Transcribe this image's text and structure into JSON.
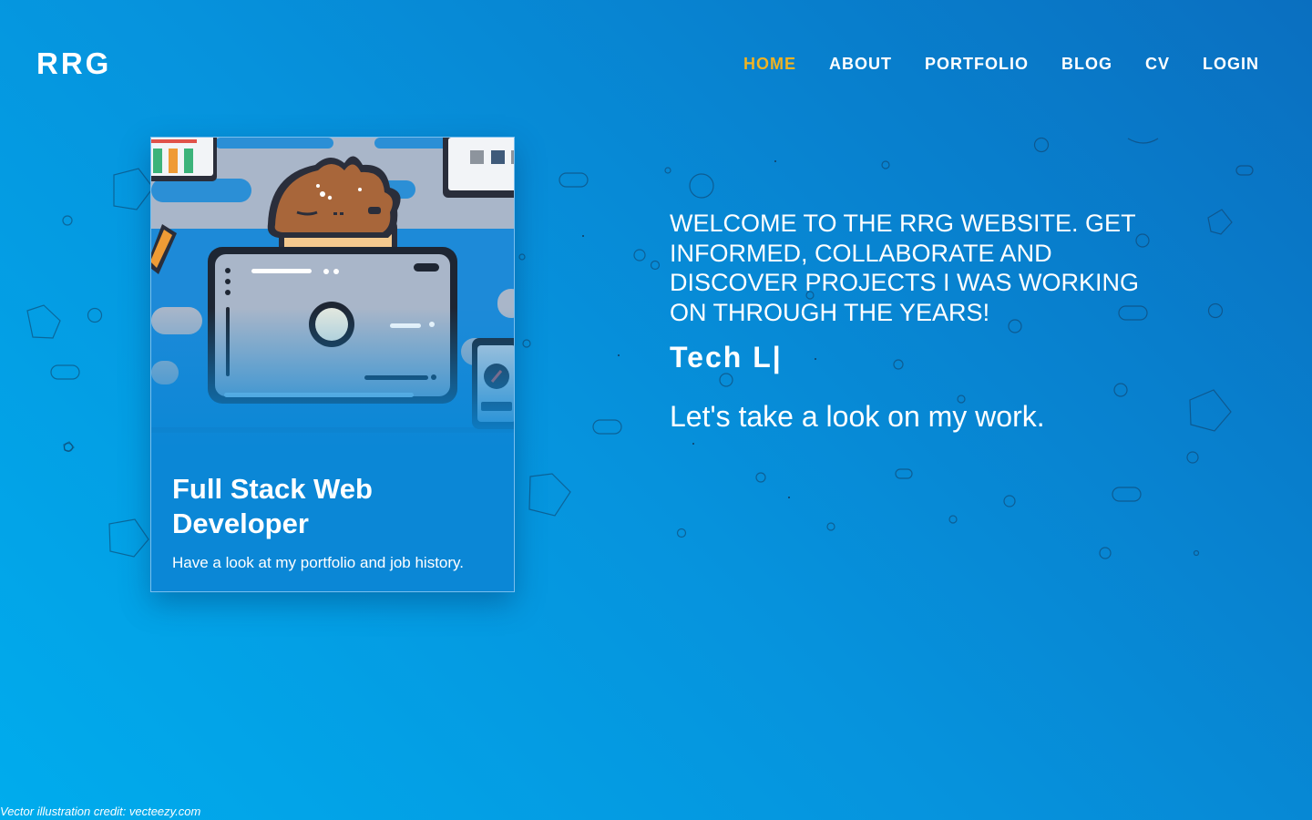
{
  "header": {
    "brand": "RRG",
    "nav": [
      {
        "label": "HOME",
        "active": true
      },
      {
        "label": "ABOUT"
      },
      {
        "label": "PORTFOLIO"
      },
      {
        "label": "BLOG"
      },
      {
        "label": "CV"
      },
      {
        "label": "LOGIN"
      }
    ]
  },
  "card": {
    "title": "Full Stack Web Developer",
    "text": "Have a look at my portfolio and job history."
  },
  "hero": {
    "heading": "WELCOME TO THE RRG WEBSITE. GET INFORMED, COLLABORATE AND DISCOVER PROJECTS I WAS WORKING ON THROUGH THE YEARS!",
    "typed": "Tech L|",
    "sub": "Let's take a look on my work."
  },
  "footer": {
    "credit": "Vector illustration credit: vecteezy.com"
  },
  "colors": {
    "accent": "#f0b323",
    "gradient_start": "#00aced",
    "gradient_end": "#0a6fc0"
  }
}
